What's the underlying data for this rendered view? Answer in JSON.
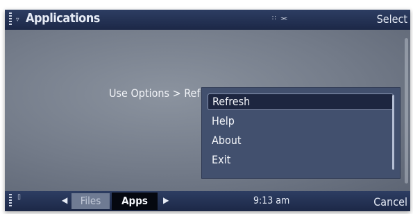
{
  "header": {
    "title": "Applications",
    "status_icons": "∷ ⫘",
    "right_softkey": "Select"
  },
  "content": {
    "hint": "Use Options > Ref"
  },
  "menu": {
    "items": [
      {
        "label": "Refresh",
        "highlighted": true
      },
      {
        "label": "Help"
      },
      {
        "label": "About"
      },
      {
        "label": "Exit"
      }
    ]
  },
  "footer": {
    "tabs": [
      {
        "label": "Files",
        "active": false
      },
      {
        "label": "Apps",
        "active": true
      }
    ],
    "time": "9:13 am",
    "right_softkey": "Cancel",
    "arrow_left": "◀",
    "arrow_right": "▶",
    "lock_glyph": "▯",
    "signal_glyph": "▿"
  }
}
